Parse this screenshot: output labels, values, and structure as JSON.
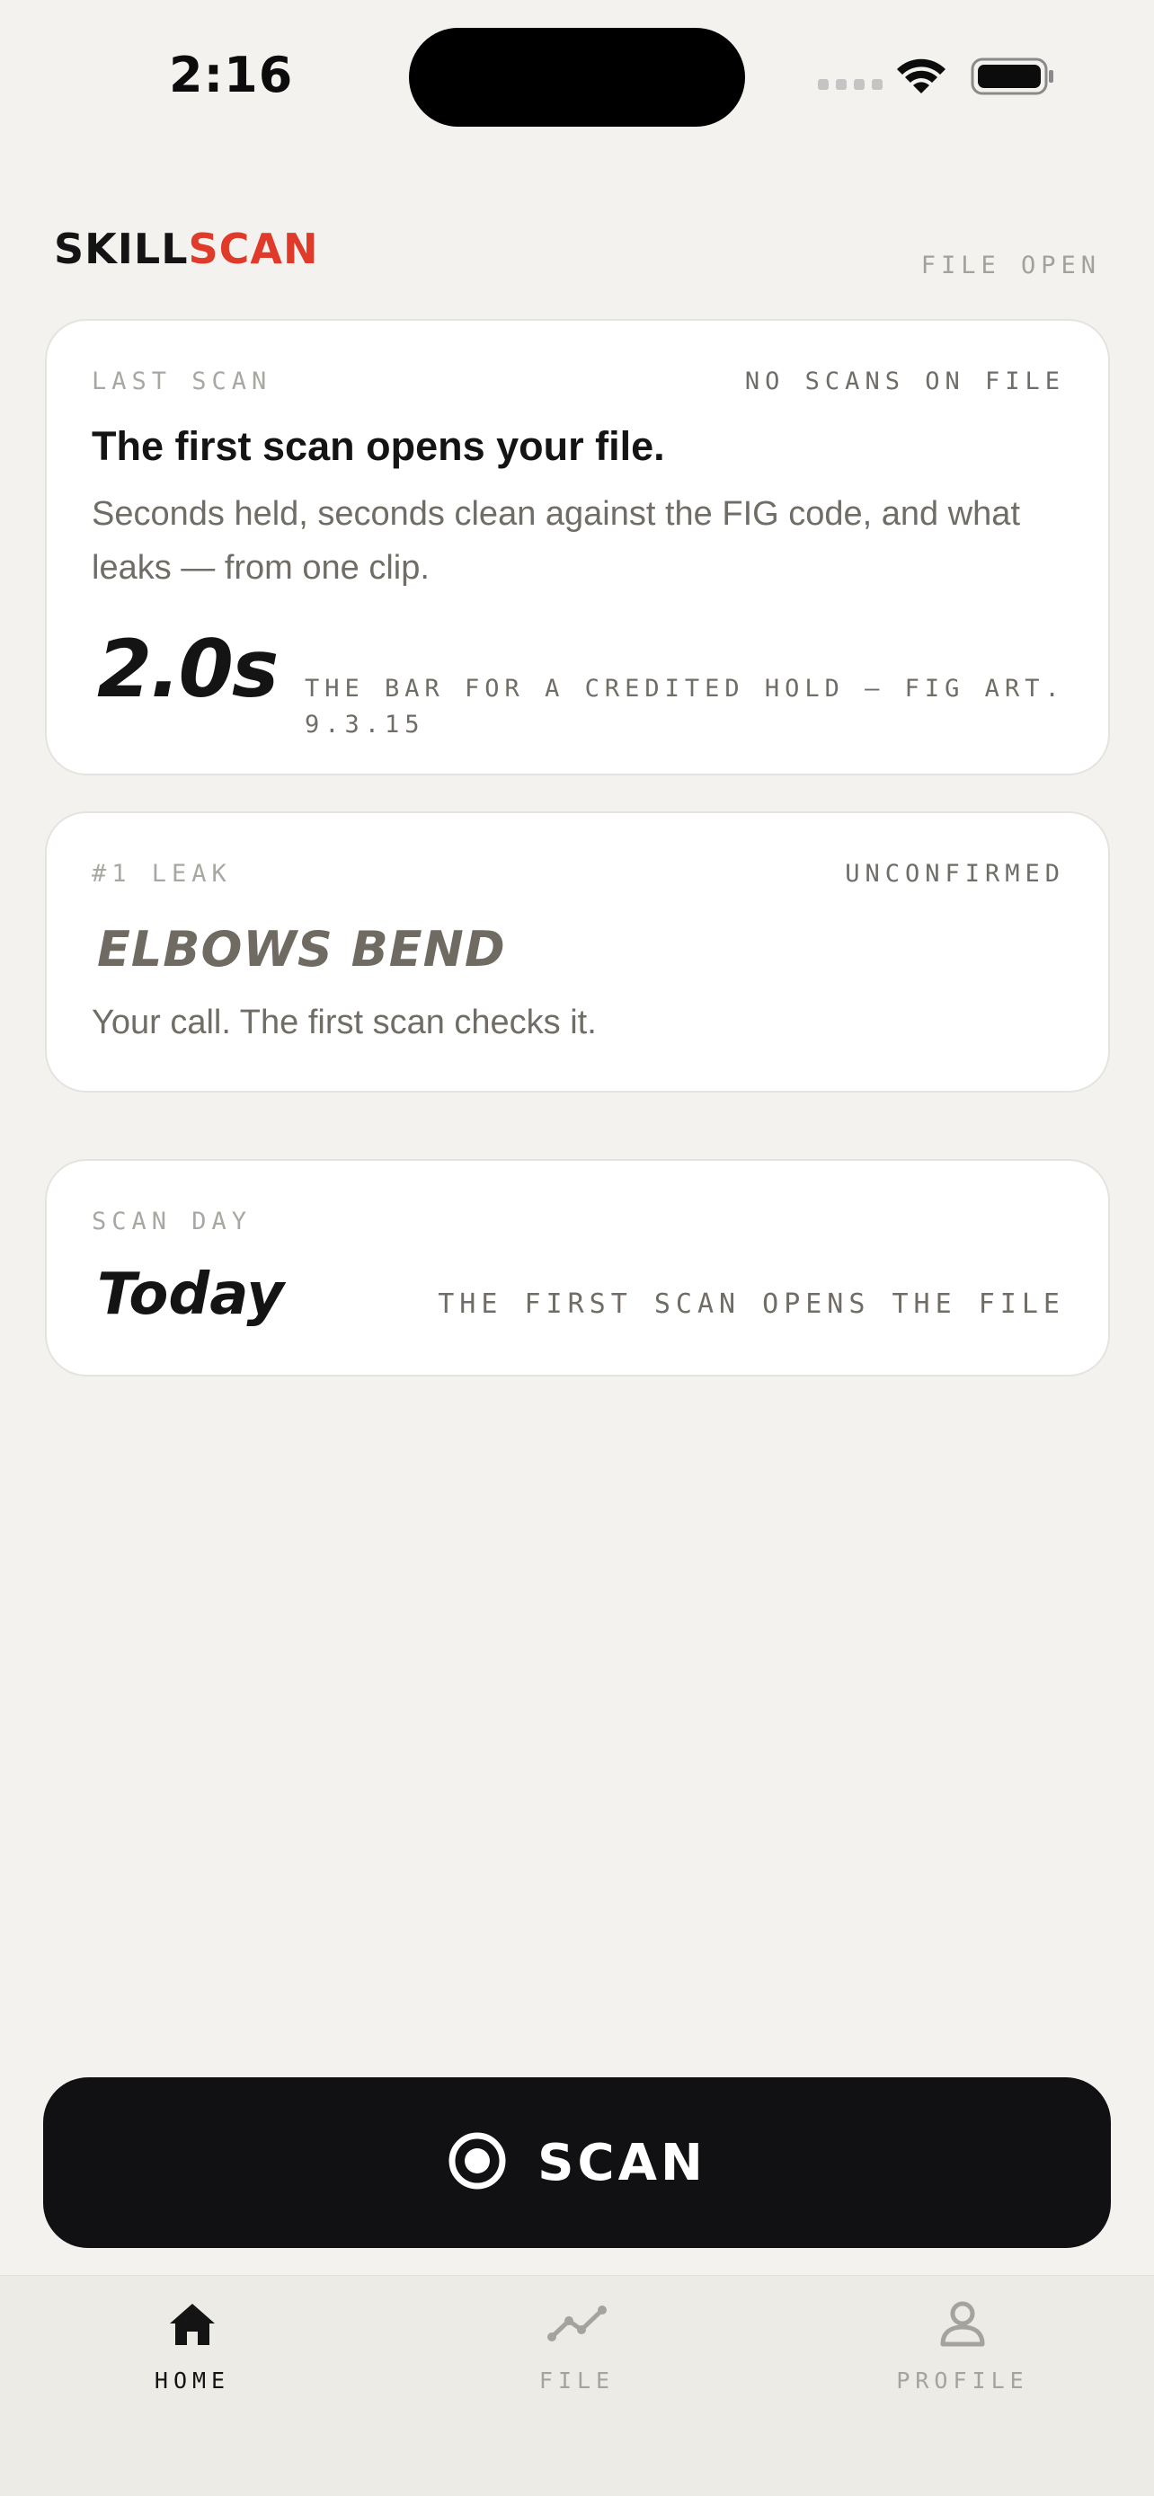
{
  "status_bar": {
    "time": "2:16",
    "icons": [
      "cellular-signal-icon",
      "wifi-icon",
      "battery-icon"
    ]
  },
  "header": {
    "brand_part1": "SKILL",
    "brand_part2": "SCAN",
    "status": "FILE OPEN"
  },
  "colors": {
    "accent": "#e03a2b",
    "background": "#f3f2ef",
    "card": "#ffffff",
    "button": "#111113"
  },
  "cards": {
    "last_scan": {
      "label": "LAST SCAN",
      "tag": "NO SCANS ON FILE",
      "headline": "The first scan opens your file.",
      "description": "Seconds held, seconds clean against the FIG code, and what leaks — from one clip.",
      "value": "2.0s",
      "caption": "THE BAR FOR A CREDITED HOLD — FIG ART. 9.3.15"
    },
    "leak": {
      "label": "#1 LEAK",
      "tag": "UNCONFIRMED",
      "title": "ELBOWS BEND",
      "description": "Your call. The first scan checks it."
    },
    "scan_day": {
      "label": "SCAN DAY",
      "value": "Today",
      "caption": "THE FIRST SCAN OPENS THE FILE"
    }
  },
  "scan_button": {
    "label": "SCAN",
    "icon": "record-target-icon"
  },
  "tabs": [
    {
      "label": "HOME",
      "icon": "home-icon",
      "active": true
    },
    {
      "label": "FILE",
      "icon": "trend-line-icon",
      "active": false
    },
    {
      "label": "PROFILE",
      "icon": "person-icon",
      "active": false
    }
  ]
}
